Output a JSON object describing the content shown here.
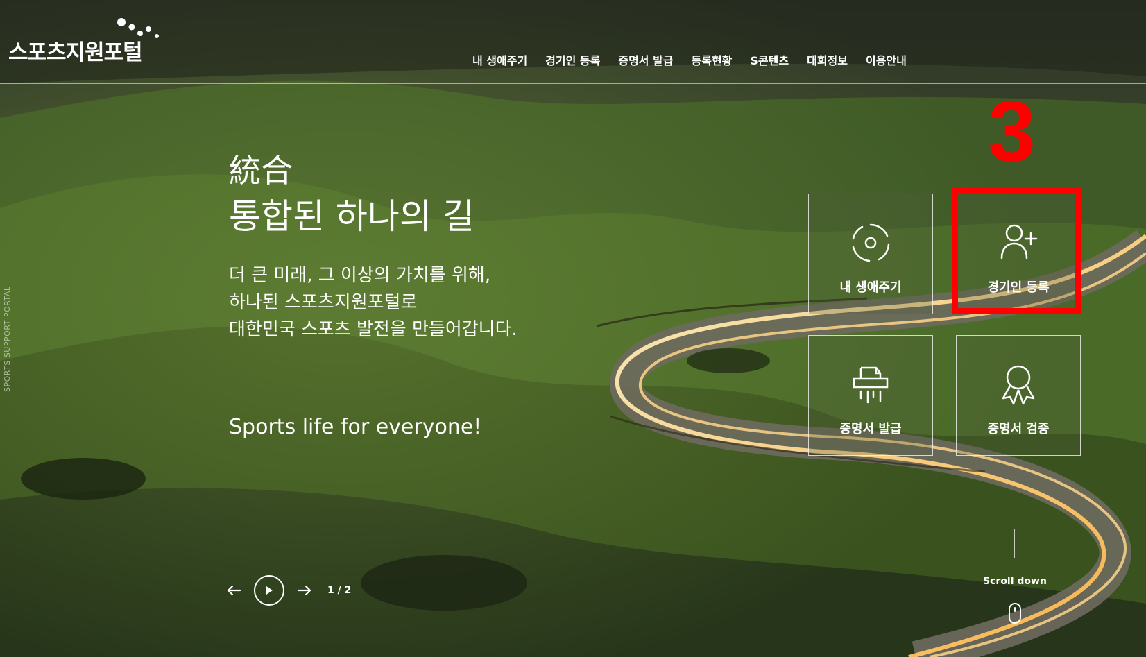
{
  "logo": {
    "text": "스포츠지원포털",
    "icon": "logo-dots-icon"
  },
  "nav": {
    "items": [
      {
        "label": "내 생애주기"
      },
      {
        "label": "경기인 등록"
      },
      {
        "label": "증명서 발급"
      },
      {
        "label": "등록현황"
      },
      {
        "label": "S콘텐츠"
      },
      {
        "label": "대회정보"
      },
      {
        "label": "이용안내"
      }
    ]
  },
  "side_text": "SPORTS SUPPORT PORTAL",
  "hero": {
    "hanja": "統合",
    "title": "통합된 하나의 길",
    "desc": [
      "더 큰 미래, 그 이상의 가치를 위해,",
      "하나된 스포츠지원포털로",
      "대한민국 스포츠 발전을 만들어갑니다."
    ],
    "slogan": "Sports life for everyone!"
  },
  "tiles": [
    {
      "label": "내 생애주기",
      "icon": "lifecycle-icon"
    },
    {
      "label": "경기인 등록",
      "icon": "add-user-icon"
    },
    {
      "label": "증명서 발급",
      "icon": "printer-icon"
    },
    {
      "label": "증명서 검증",
      "icon": "award-ribbon-icon"
    }
  ],
  "annotation": {
    "step_number": "3",
    "color": "#ff0000"
  },
  "slider": {
    "counter": "1 / 2"
  },
  "scroll": {
    "label": "Scroll down"
  }
}
